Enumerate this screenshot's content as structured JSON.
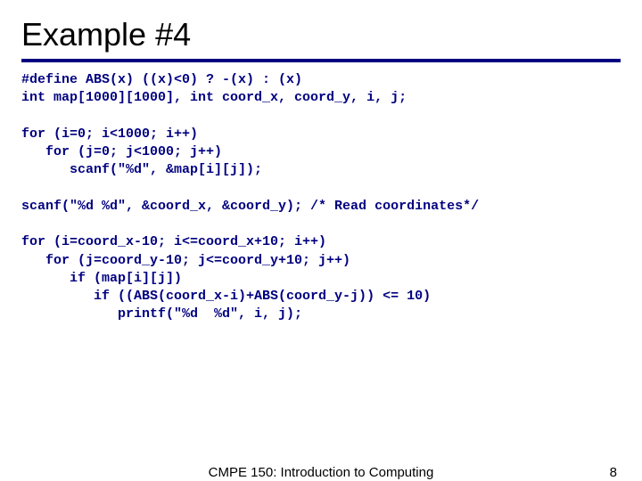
{
  "title": "Example #4",
  "code": "#define ABS(x) ((x)<0) ? -(x) : (x)\nint map[1000][1000], int coord_x, coord_y, i, j;\n\nfor (i=0; i<1000; i++)\n   for (j=0; j<1000; j++)\n      scanf(\"%d\", &map[i][j]);\n\nscanf(\"%d %d\", &coord_x, &coord_y); /* Read coordinates*/\n\nfor (i=coord_x-10; i<=coord_x+10; i++)\n   for (j=coord_y-10; j<=coord_y+10; j++)\n      if (map[i][j])\n         if ((ABS(coord_x-i)+ABS(coord_y-j)) <= 10)\n            printf(\"%d  %d\", i, j);",
  "footer": {
    "course": "CMPE 150: Introduction to Computing",
    "page": "8"
  }
}
